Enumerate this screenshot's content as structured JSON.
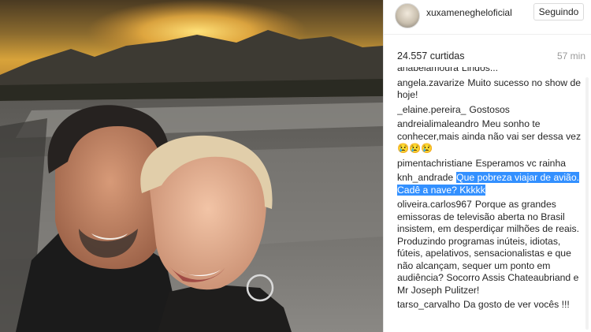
{
  "post": {
    "username": "xuxamenegheloficial",
    "follow_label": "Seguindo",
    "likes_text": "24.557 curtidas",
    "time_text": "57 min"
  },
  "comments": [
    {
      "user": "anabelamoura",
      "text": "Lindos..."
    },
    {
      "user": "angela.zavarize",
      "text": "Muito sucesso no show de hoje!"
    },
    {
      "user": "_elaine.pereira_",
      "text": "Gostosos"
    },
    {
      "user": "andreialimaleandro",
      "text": "Meu sonho te conhecer,mais ainda não vai ser dessa vez😢😢😢"
    },
    {
      "user": "pimentachristiane",
      "text": "Esperamos vc rainha"
    },
    {
      "user": "knh_andrade",
      "text": "Que pobreza viajar de avião. Cadê a nave? Kkkkk"
    },
    {
      "user": "oliveira.carlos967",
      "text": "Porque as grandes emissoras de televisão aberta no Brasil insistem, em desperdiçar milhões de reais. Produzindo programas inúteis, idiotas, fúteis, apelativos, sensacionalistas e que não alcançam, sequer um ponto em audiência? Socorro Assis Chateaubriand e Mr Joseph Pulitzer!"
    },
    {
      "user": "tarso_carvalho",
      "text": "Da gosto de ver vocês !!!"
    }
  ]
}
